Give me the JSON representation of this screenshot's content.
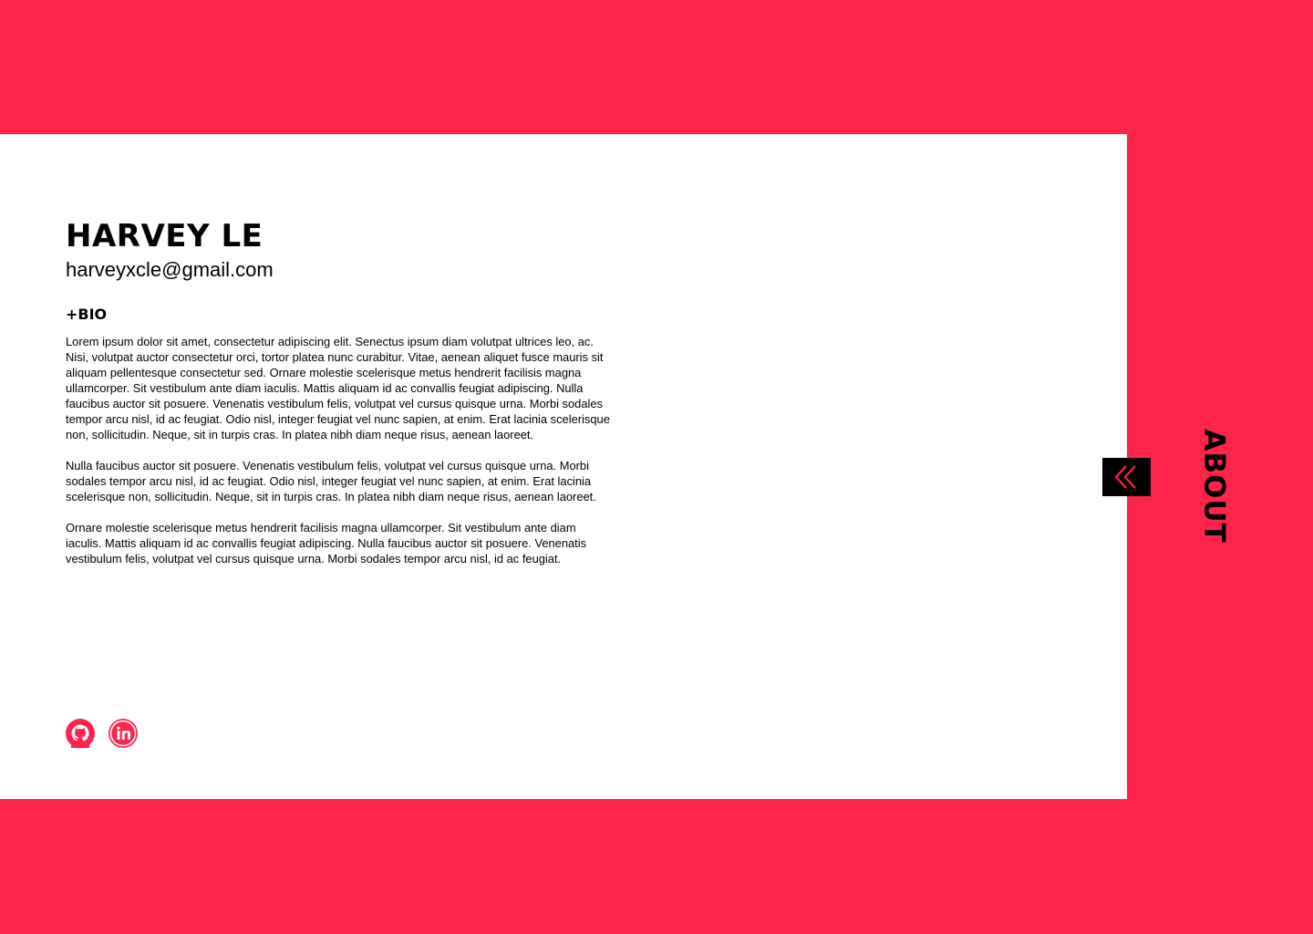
{
  "profile": {
    "name": "HARVEY LE",
    "email": "harveyxcle@gmail.com"
  },
  "bio": {
    "title": "+BIO",
    "paragraphs": [
      "Lorem ipsum dolor sit amet, consectetur adipiscing elit. Senectus ipsum diam volutpat ultrices leo, ac. Nisi, volutpat auctor consectetur orci, tortor platea nunc curabitur. Vitae, aenean aliquet fusce mauris sit aliquam pellentesque consectetur sed. Ornare molestie scelerisque metus hendrerit facilisis magna ullamcorper. Sit vestibulum ante diam iaculis. Mattis aliquam id ac convallis feugiat adipiscing. Nulla faucibus auctor sit posuere. Venenatis vestibulum felis, volutpat vel cursus quisque urna. Morbi sodales tempor arcu nisl, id ac feugiat. Odio nisl, integer feugiat vel nunc sapien, at enim. Erat lacinia scelerisque non, sollicitudin. Neque, sit in turpis cras. In platea nibh diam neque risus, aenean laoreet.",
      "Nulla faucibus auctor sit posuere. Venenatis vestibulum felis, volutpat vel cursus quisque urna. Morbi sodales tempor arcu nisl, id ac feugiat. Odio nisl, integer feugiat vel nunc sapien, at enim. Erat lacinia scelerisque non, sollicitudin. Neque, sit in turpis cras. In platea nibh diam neque risus, aenean laoreet.",
      "Ornare molestie scelerisque metus hendrerit facilisis magna ullamcorper. Sit vestibulum ante diam iaculis. Mattis aliquam id ac convallis feugiat adipiscing. Nulla faucibus auctor sit posuere. Venenatis vestibulum felis, volutpat vel cursus quisque urna. Morbi sodales tempor arcu nisl, id ac feugiat."
    ]
  },
  "socials": [
    {
      "icon": "github-icon"
    },
    {
      "icon": "linkedin-icon"
    }
  ],
  "side_panel": {
    "label": "ABOUT",
    "collapse_icon": "double-chevron-left-icon"
  },
  "colors": {
    "accent": "#ff2449",
    "card": "#ffffff",
    "text": "#000000"
  }
}
